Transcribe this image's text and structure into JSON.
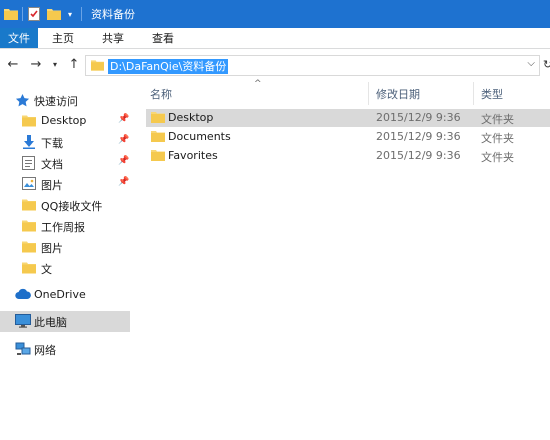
{
  "window": {
    "title": "资料备份"
  },
  "ribbon": {
    "tabs": [
      {
        "label": "文件"
      },
      {
        "label": "主页"
      },
      {
        "label": "共享"
      },
      {
        "label": "查看"
      }
    ]
  },
  "address": {
    "path": "D:\\DaFanQie\\资料备份"
  },
  "nav": {
    "quick_access": "快速访问",
    "quick_items": [
      {
        "label": "Desktop",
        "icon": "folder-icon",
        "pinned": true
      },
      {
        "label": "下载",
        "icon": "download-icon",
        "pinned": true
      },
      {
        "label": "文档",
        "icon": "documents-icon",
        "pinned": true
      },
      {
        "label": "图片",
        "icon": "pictures-icon",
        "pinned": true
      },
      {
        "label": "QQ接收文件",
        "icon": "folder-icon",
        "pinned": false
      },
      {
        "label": "工作周报",
        "icon": "folder-icon",
        "pinned": false
      },
      {
        "label": "图片",
        "icon": "folder-icon",
        "pinned": false
      },
      {
        "label": "文",
        "icon": "folder-icon",
        "pinned": false
      }
    ],
    "onedrive": "OneDrive",
    "this_pc": "此电脑",
    "network": "网络"
  },
  "columns": {
    "name": "名称",
    "modified": "修改日期",
    "type": "类型"
  },
  "files": [
    {
      "name": "Desktop",
      "modified": "2015/12/9 9:36",
      "type": "文件夹"
    },
    {
      "name": "Documents",
      "modified": "2015/12/9 9:36",
      "type": "文件夹"
    },
    {
      "name": "Favorites",
      "modified": "2015/12/9 9:36",
      "type": "文件夹"
    }
  ],
  "colors": {
    "titlebar": "#1e72d0",
    "file_tab": "#1979ca",
    "selection": "#d9d9d9",
    "address_highlight": "#3399ff",
    "folder": "#f8d775"
  }
}
